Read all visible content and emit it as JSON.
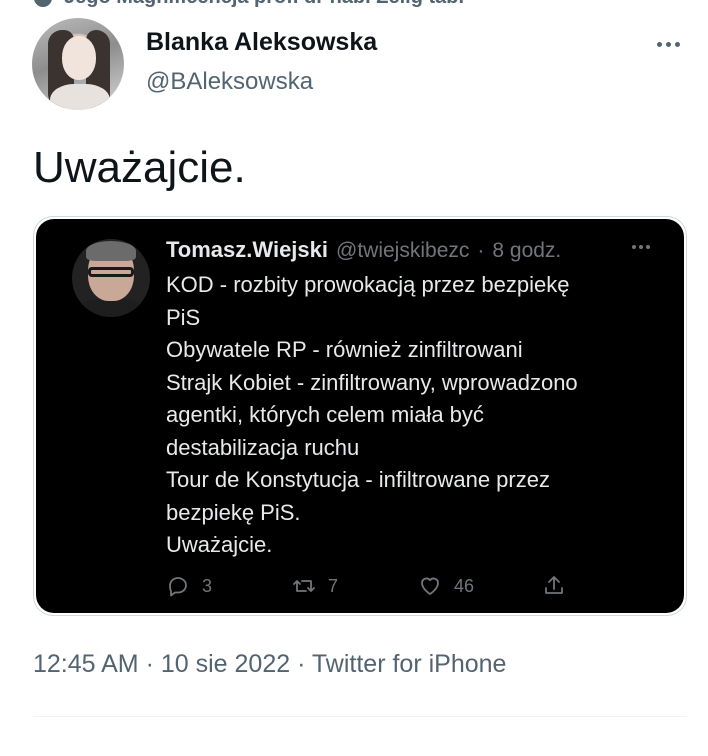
{
  "top_strip": {
    "text": "Jego Magnificencja prof. dr hab. Zelig tab."
  },
  "author": {
    "display_name": "Blanka Aleksowska",
    "handle": "@BAleksowska"
  },
  "tweet": {
    "text": "Uważajcie."
  },
  "quoted": {
    "name": "Tomasz.Wiejski",
    "handle": "@twiejskibezc",
    "separator": "·",
    "time": "8 godz.",
    "lines": [
      "KOD - rozbity prowokacją przez bezpiekę",
      "PiS",
      "Obywatele RP - również zinfiltrowani",
      "Strajk Kobiet - zinfiltrowany, wprowadzono",
      "agentki, których celem miała być",
      "destabilizacja ruchu",
      "Tour de Konstytucja - infiltrowane przez",
      "bezpiekę PiS.",
      "Uważajcie."
    ],
    "actions": {
      "reply_count": "3",
      "retweet_count": "7",
      "like_count": "46"
    }
  },
  "meta": {
    "time": "12:45 AM",
    "sep1": " · ",
    "date": "10 sie 2022",
    "sep2": " · ",
    "source": "Twitter for iPhone"
  }
}
